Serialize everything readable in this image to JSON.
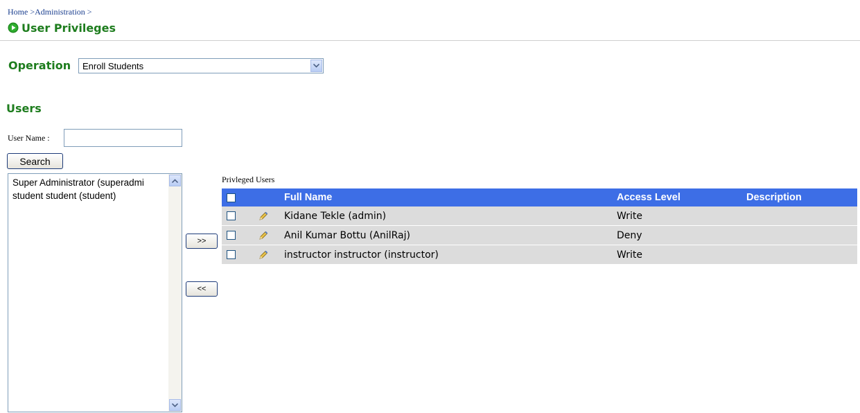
{
  "breadcrumb": {
    "home": "Home",
    "sep1": " >",
    "admin": "Administration",
    "sep2": " >"
  },
  "page": {
    "title": "User Privileges",
    "title_icon": "play-circle-icon"
  },
  "operation": {
    "label": "Operation",
    "selected": "Enroll Students"
  },
  "users": {
    "heading": "Users",
    "username_label": "User Name :",
    "username_value": "",
    "search_label": "Search",
    "list_items": [
      {
        "label": "Super Administrator (superadmi"
      },
      {
        "label": "student student (student)"
      }
    ]
  },
  "transfer": {
    "add_label": ">>",
    "remove_label": "<<"
  },
  "privileged": {
    "label": "Privleged Users",
    "columns": {
      "full_name": "Full Name",
      "access_level": "Access Level",
      "description": "Description"
    },
    "rows": [
      {
        "full_name": "Kidane Tekle (admin)",
        "access_level": "Write",
        "description": ""
      },
      {
        "full_name": "Anil Kumar Bottu (AnilRaj)",
        "access_level": "Deny",
        "description": ""
      },
      {
        "full_name": "instructor instructor (instructor)",
        "access_level": "Write",
        "description": ""
      }
    ]
  },
  "colors": {
    "title_green": "#1e7d1e",
    "header_blue": "#3d6ee6",
    "row_gray": "#dcdcdc",
    "link_blue": "#1b3f8f"
  }
}
